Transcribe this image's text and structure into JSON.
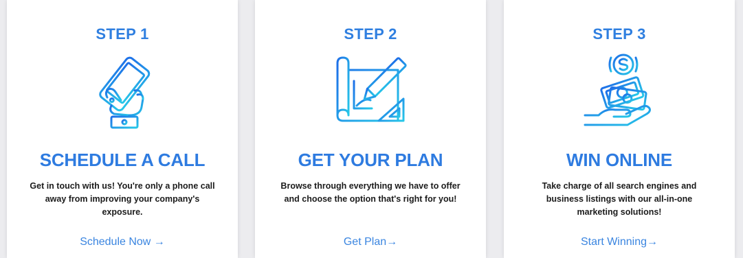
{
  "colors": {
    "accent": "#2f7fe0",
    "icon_gradient_start": "#1e90ff",
    "icon_gradient_end": "#2ad0e8",
    "body_text": "#1b1b1b",
    "card_bg": "#ffffff",
    "page_bg": "#ececef"
  },
  "steps": [
    {
      "step_label": "STEP 1",
      "icon": "phone-in-hand-icon",
      "title": "SCHEDULE A CALL",
      "description": "Get in touch with us! You're only a phone call away from improving your company's exposure.",
      "link_label": "Schedule Now →"
    },
    {
      "step_label": "STEP 2",
      "icon": "blueprint-pencil-icon",
      "title": "GET YOUR PLAN",
      "description": "Browse through everything we have to offer and choose the option that's right for you!",
      "link_label": "Get Plan→"
    },
    {
      "step_label": "STEP 3",
      "icon": "money-in-hand-icon",
      "title": "WIN ONLINE",
      "description": "Take charge of all search engines and business listings with our all-in-one marketing solutions!",
      "link_label": "Start Winning→"
    }
  ]
}
